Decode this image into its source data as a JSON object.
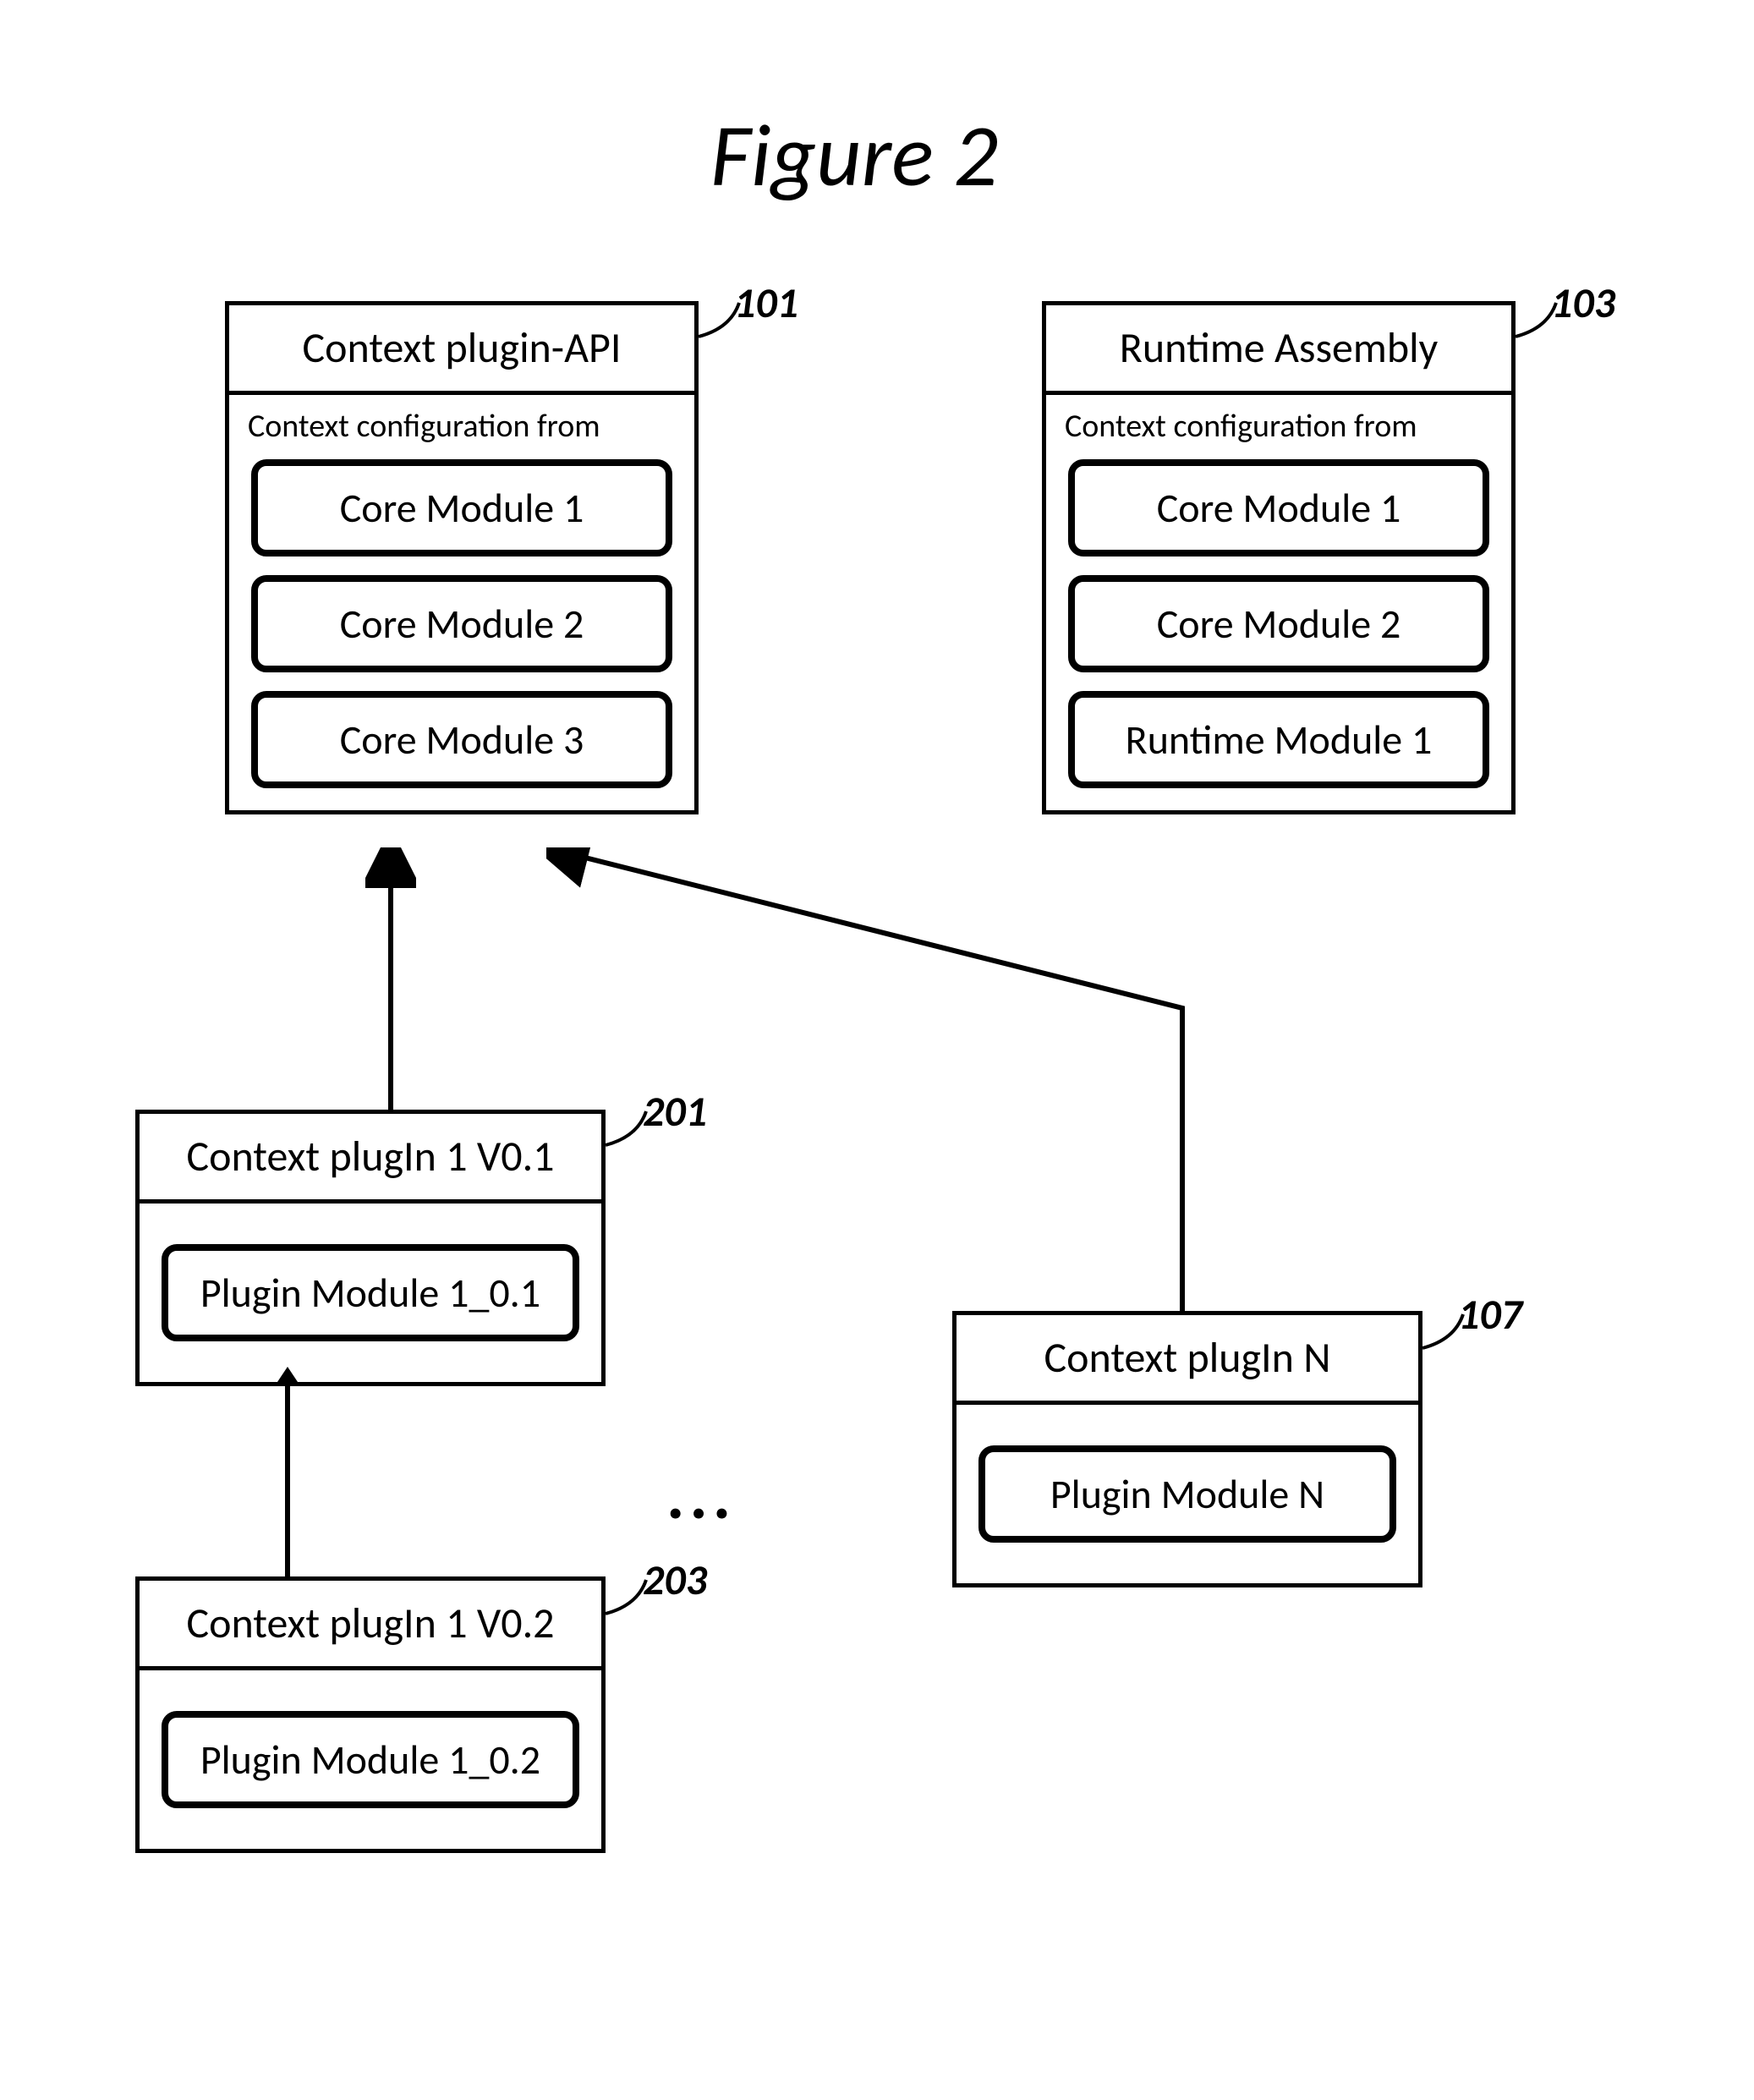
{
  "title": "Figure 2",
  "ref": {
    "r101": "101",
    "r103": "103",
    "r201": "201",
    "r203": "203",
    "r107": "107"
  },
  "api": {
    "header": "Context plugin-API",
    "sub": "Context configuration from",
    "m1": "Core Module 1",
    "m2": "Core Module 2",
    "m3": "Core Module 3"
  },
  "runtime": {
    "header": "Runtime Assembly",
    "sub": "Context configuration from",
    "m1": "Core Module 1",
    "m2": "Core Module 2",
    "m3": "Runtime Module 1"
  },
  "p201": {
    "header": "Context plugIn 1 V0.1",
    "m1": "Plugin Module 1_0.1"
  },
  "p203": {
    "header": "Context plugIn 1 V0.2",
    "m1": "Plugin Module 1_0.2"
  },
  "p107": {
    "header": "Context plugIn N",
    "m1": "Plugin Module N"
  },
  "ellipsis": "..."
}
